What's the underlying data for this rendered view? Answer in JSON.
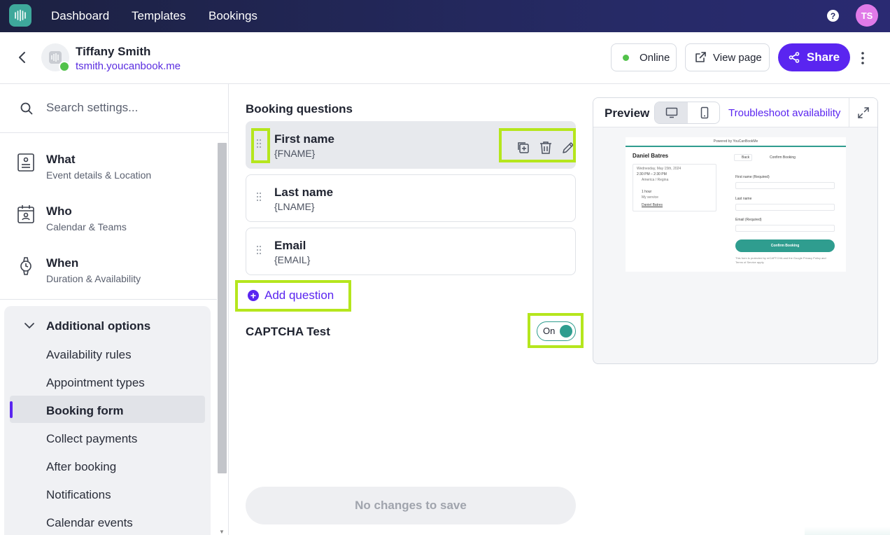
{
  "nav": {
    "links": [
      "Dashboard",
      "Templates",
      "Bookings"
    ],
    "avatar_initials": "TS",
    "help_glyph": "?"
  },
  "profile": {
    "name": "Tiffany Smith",
    "link": "tsmith.youcanbook.me"
  },
  "header_actions": {
    "online_label": "Online",
    "view_page_label": "View page",
    "share_label": "Share"
  },
  "sidebar": {
    "search_placeholder": "Search settings...",
    "sections": [
      {
        "title": "What",
        "subtitle": "Event details & Location",
        "icon": "document-icon"
      },
      {
        "title": "Who",
        "subtitle": "Calendar & Teams",
        "icon": "calendar-person-icon"
      },
      {
        "title": "When",
        "subtitle": "Duration & Availability",
        "icon": "watch-icon"
      }
    ],
    "additional": {
      "title": "Additional options",
      "items": [
        "Availability rules",
        "Appointment types",
        "Booking form",
        "Collect payments",
        "After booking",
        "Notifications",
        "Calendar events"
      ],
      "active": "Booking form"
    }
  },
  "main": {
    "section_title": "Booking questions",
    "questions": [
      {
        "name": "First name",
        "token": "{FNAME}"
      },
      {
        "name": "Last name",
        "token": "{LNAME}"
      },
      {
        "name": "Email",
        "token": "{EMAIL}"
      }
    ],
    "add_question_label": "Add question",
    "captcha_label": "CAPTCHA Test",
    "captcha_toggle": "On",
    "save_label": "No changes to save"
  },
  "preview": {
    "title": "Preview",
    "troubleshoot_label": "Troubleshoot availability",
    "mini": {
      "powered": "Powered by YouCanBookMe",
      "host": "Daniel Batres",
      "date": "Wednesday, May 15th, 2024",
      "time": "2:30 PM – 2:30 PM",
      "timezone": "America / Regina",
      "duration": "1 hour",
      "service": "My service",
      "person": "Daniel Batres",
      "back": "Back",
      "confirm_heading": "Confirm Booking",
      "field_first": "First name (Required)",
      "field_last": "Last name",
      "field_email": "Email (Required)",
      "confirm_btn": "Confirm Booking",
      "recaptcha_line1": "This form is protected by reCAPTCHA and the Google Privacy Policy and",
      "recaptcha_line2": "Terms of Service apply."
    }
  },
  "colors": {
    "nav_bg": "#232a5c",
    "accent": "#5a25f0",
    "teal": "#2f9d8f",
    "online": "#52c24a",
    "highlight": "#b5e61d"
  }
}
